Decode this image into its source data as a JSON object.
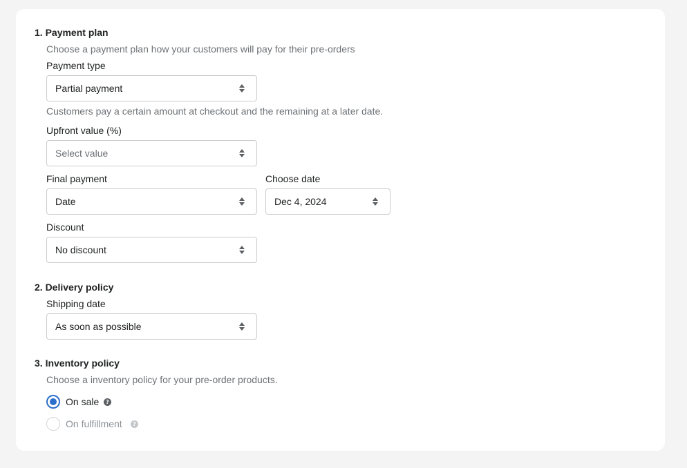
{
  "payment_plan": {
    "title": "1. Payment plan",
    "description": "Choose a payment plan how your customers will pay for their pre-orders",
    "payment_type": {
      "label": "Payment type",
      "value": "Partial payment",
      "helper": "Customers pay a certain amount at checkout and the remaining at a later date."
    },
    "upfront_value": {
      "label": "Upfront value (%)",
      "placeholder": "Select value"
    },
    "final_payment": {
      "label": "Final payment",
      "value": "Date"
    },
    "choose_date": {
      "label": "Choose date",
      "value": "Dec 4, 2024"
    },
    "discount": {
      "label": "Discount",
      "value": "No discount"
    }
  },
  "delivery_policy": {
    "title": "2. Delivery policy",
    "shipping_date": {
      "label": "Shipping date",
      "value": "As soon as possible"
    }
  },
  "inventory_policy": {
    "title": "3. Inventory policy",
    "description": "Choose a inventory policy for your pre-order products.",
    "options": [
      {
        "label": "On sale",
        "selected": true,
        "disabled": false,
        "help_icon": "question-circle-icon"
      },
      {
        "label": "On fulfillment",
        "selected": false,
        "disabled": true,
        "help_icon": "question-circle-icon"
      }
    ]
  },
  "colors": {
    "accent": "#2c6ecb",
    "page_background": "#f4f4f4",
    "card_background": "#ffffff",
    "text": "#202223",
    "subdued_text": "#6d7175",
    "border": "#c9cccf"
  }
}
